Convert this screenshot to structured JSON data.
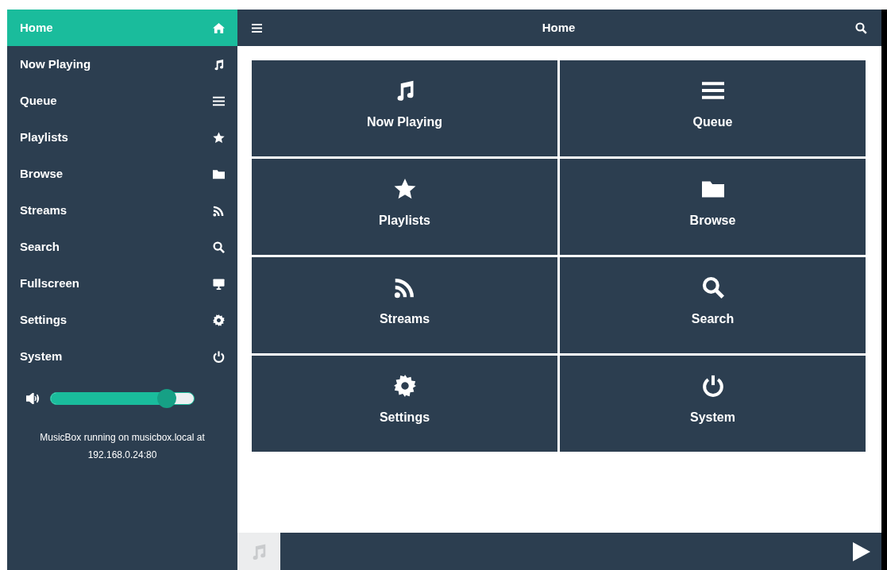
{
  "sidebar": {
    "items": [
      {
        "label": "Home",
        "selected": true
      },
      {
        "label": "Now Playing",
        "selected": false
      },
      {
        "label": "Queue",
        "selected": false
      },
      {
        "label": "Playlists",
        "selected": false
      },
      {
        "label": "Browse",
        "selected": false
      },
      {
        "label": "Streams",
        "selected": false
      },
      {
        "label": "Search",
        "selected": false
      },
      {
        "label": "Fullscreen",
        "selected": false
      },
      {
        "label": "Settings",
        "selected": false
      },
      {
        "label": "System",
        "selected": false
      }
    ],
    "volume": {
      "level": 0.84
    },
    "status": "MusicBox running on musicbox.local at 192.168.0.24:80"
  },
  "header": {
    "title": "Home"
  },
  "tiles": [
    {
      "label": "Now Playing"
    },
    {
      "label": "Queue"
    },
    {
      "label": "Playlists"
    },
    {
      "label": "Browse"
    },
    {
      "label": "Streams"
    },
    {
      "label": "Search"
    },
    {
      "label": "Settings"
    },
    {
      "label": "System"
    }
  ]
}
